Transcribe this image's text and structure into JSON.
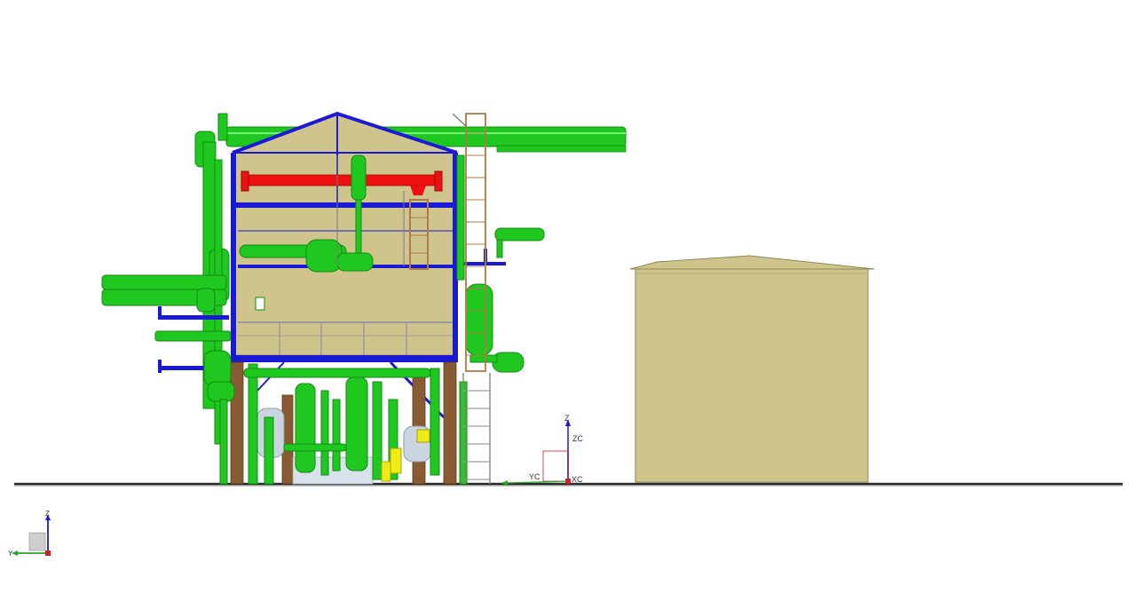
{
  "viewport": {
    "background": "#ffffff"
  },
  "colors": {
    "pipe_green": "#1fc81f",
    "pipe_green_dark": "#138a13",
    "steel_blue": "#1a1ad6",
    "crane_red": "#ee1010",
    "panel_khaki": "#cfc58c",
    "column_brown": "#8a5a32",
    "ladder_brown": "#b07a45",
    "vessel_grey": "#c9d6df",
    "yellow_part": "#f2ea16",
    "ground_line": "#2a2a2a"
  },
  "work_csys": {
    "z_label": "Z",
    "zc_label": "ZC",
    "yc_label": "YC",
    "xc_label": "XC"
  },
  "view_triad": {
    "z_label": "Z",
    "y_label": "Y"
  }
}
